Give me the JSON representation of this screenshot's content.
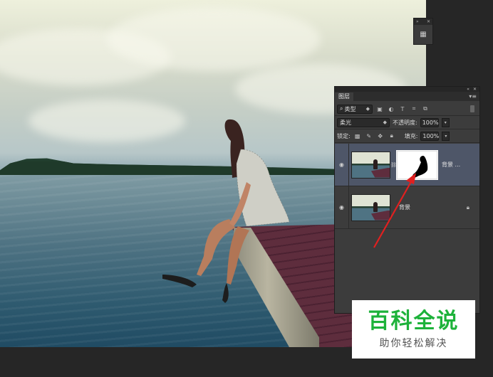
{
  "colors": {
    "panel_bg": "#3c3c3c",
    "selected_layer": "#4e5668",
    "annotation_arrow": "#e02020",
    "watermark_green": "#1db23a"
  },
  "mini_panel": {
    "icon": "layers-panel-icon"
  },
  "layers_panel": {
    "tab_label": "图层",
    "menu_icon": "panel-menu-icon",
    "filter": {
      "kind_value": "类型",
      "icons": [
        "image-filter-icon",
        "adjustment-filter-icon",
        "type-filter-icon",
        "shape-filter-icon",
        "smart-object-filter-icon"
      ]
    },
    "blend_mode": "柔光",
    "opacity_label": "不透明度:",
    "opacity_value": "100%",
    "lock_label": "锁定:",
    "lock_icons": [
      "lock-transparent-icon",
      "lock-paint-icon",
      "lock-move-icon",
      "lock-all-icon"
    ],
    "fill_label": "填充:",
    "fill_value": "100%",
    "layers": [
      {
        "name": "背景 ...",
        "selected": true,
        "has_mask": true
      },
      {
        "name": "背景",
        "selected": false,
        "locked": true
      }
    ]
  },
  "watermark": {
    "title": "百科全说",
    "subtitle": "助你轻松解决"
  }
}
